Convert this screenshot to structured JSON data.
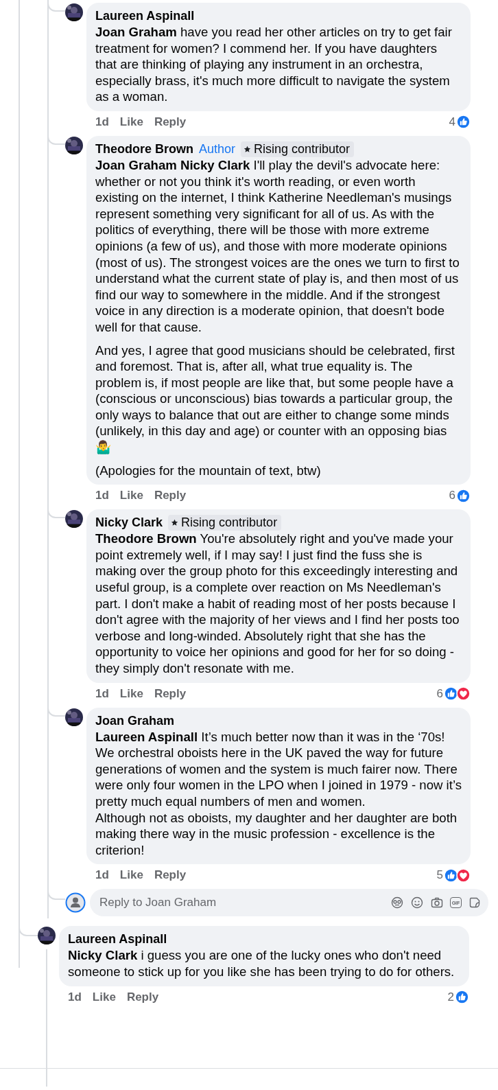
{
  "nested_replies": [
    {
      "author": "Laureen Aspinall",
      "paragraphs": [
        "**Joan Graham** have you read her other articles on try to get fair treatment for women? I commend her. If you have daughters that are thinking of playing any instrument in an orchestra, especially brass, it's much more difficult to navigate the system as a woman."
      ],
      "time": "1d",
      "like": "Like",
      "reply": "Reply",
      "count": "4",
      "reactions": [
        {
          "kind": "like"
        }
      ]
    },
    {
      "author": "Theodore Brown",
      "badges": [
        {
          "kind": "author",
          "label": "Author"
        },
        {
          "kind": "contributor",
          "label": "Rising contributor"
        }
      ],
      "paragraphs": [
        "**Joan Graham Nicky Clark** I'll play the devil's advocate here: whether or not you think it's worth reading, or even worth existing on the internet, I think Katherine Needleman's musings represent something very significant for all of us. As with the politics of everything, there will be those with more extreme opinions (a few of us), and those with more moderate opinions (most of us). The strongest voices are the ones we turn to first to understand what the current state of play is, and then most of us find our way to somewhere in the middle. And if the strongest voice in any direction is a moderate opinion, that doesn't bode well for that cause.",
        "And yes, I agree that good musicians should be celebrated, first and foremost. That is, after all, what true equality is. The problem is, if most people are like that, but some people have a (conscious or unconscious) bias towards a particular group, the only ways to balance that out are either to change some minds (unlikely, in this day and age) or counter with an opposing bias 🤷‍♂️",
        "(Apologies for the mountain of text, btw)"
      ],
      "time": "1d",
      "like": "Like",
      "reply": "Reply",
      "count": "6",
      "reactions": [
        {
          "kind": "like"
        }
      ]
    },
    {
      "author": "Nicky Clark",
      "badges": [
        {
          "kind": "contributor",
          "label": "Rising contributor"
        }
      ],
      "paragraphs": [
        "**Theodore Brown** You're absolutely right and you've made your point extremely well, if I may say! I just find the fuss she is making over the group photo for this exceedingly interesting and useful group, is a complete over reaction on Ms Needleman's part. I don't make a habit of reading most of her posts because I don't agree with the majority of her views and I find her posts too verbose and long-winded. Absolutely right that she has the opportunity to voice her opinions and good for her for so doing - they simply don't resonate with me."
      ],
      "time": "1d",
      "like": "Like",
      "reply": "Reply",
      "count": "6",
      "reactions": [
        {
          "kind": "like"
        },
        {
          "kind": "love"
        }
      ]
    },
    {
      "author": "Joan Graham",
      "paragraphs": [
        "**Laureen Aspinall** It’s much better now than it was in the ‘70s! We orchestral oboists here in the UK paved the way for future generations of women and the system is much fairer now. There were only four women in the LPO when I joined in 1979 - now it’s pretty much equal numbers of men and women.\nAlthough not as oboists, my daughter and her daughter are both making there way in the music profession - excellence is the criterion!"
      ],
      "time": "1d",
      "like": "Like",
      "reply": "Reply",
      "count": "5",
      "reactions": [
        {
          "kind": "like"
        },
        {
          "kind": "love"
        }
      ]
    }
  ],
  "reply_box": {
    "placeholder": "Reply to Joan Graham",
    "gif_label": "GIF"
  },
  "comments": [
    {
      "author": "Laureen Aspinall",
      "paragraphs": [
        "**Nicky Clark** i guess you are one of the lucky ones who don't need someone to stick up for you like she has been trying to do for others."
      ],
      "time": "1d",
      "like": "Like",
      "reply": "Reply",
      "count": "2",
      "reactions": [
        {
          "kind": "like"
        }
      ]
    }
  ]
}
